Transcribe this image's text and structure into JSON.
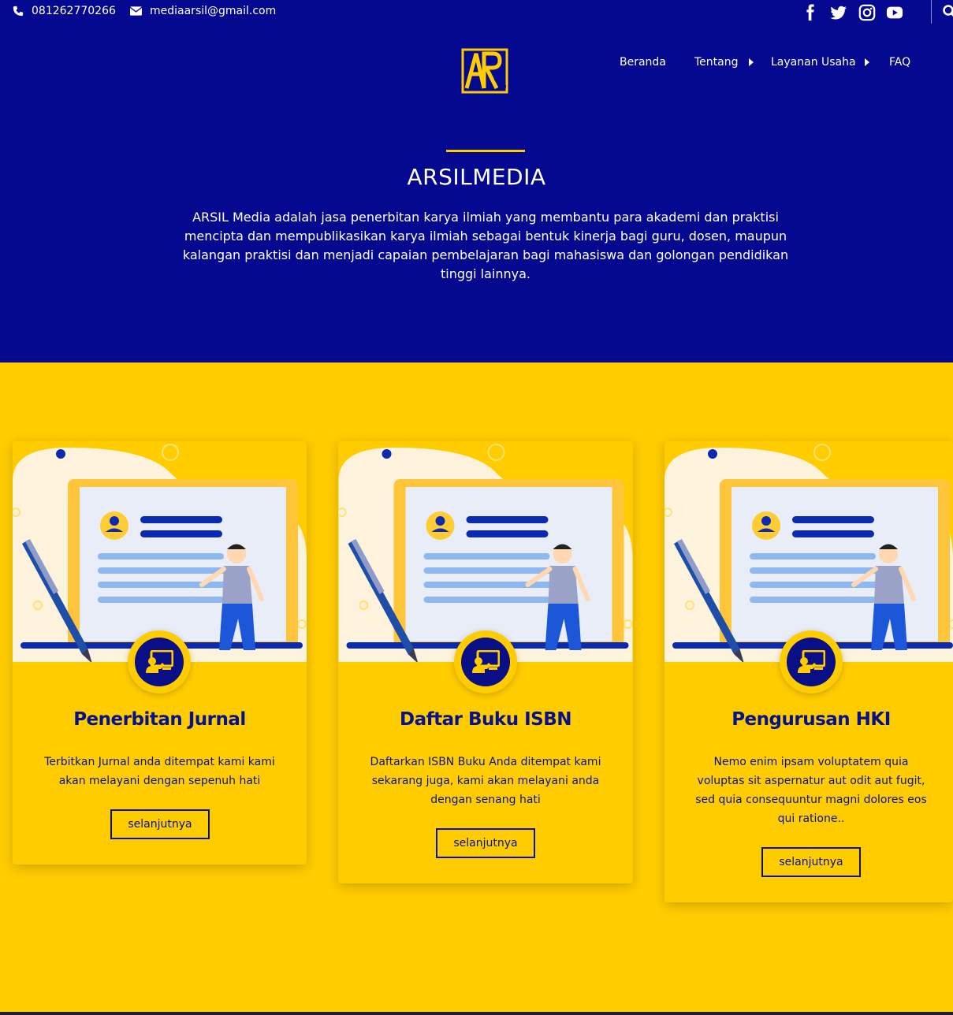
{
  "topbar": {
    "phone": "081262770266",
    "email": "mediaarsil@gmail.com",
    "social": [
      "facebook-icon",
      "twitter-icon",
      "instagram-icon",
      "youtube-icon"
    ]
  },
  "nav": {
    "items": [
      {
        "label": "Beranda",
        "has_submenu": false
      },
      {
        "label": "Tentang",
        "has_submenu": true
      },
      {
        "label": "Layanan Usaha",
        "has_submenu": true
      },
      {
        "label": "FAQ",
        "has_submenu": false
      }
    ]
  },
  "hero": {
    "title": "ARSILMEDIA",
    "description": "ARSIL Media adalah jasa penerbitan karya ilmiah yang membantu para akademi dan praktisi mencipta dan mempublikasikan karya ilmiah sebagai bentuk kinerja bagi guru, dosen, maupun kalangan praktisi dan menjadi capaian pembelajaran bagi mahasiswa dan golongan pendidikan tinggi lainnya."
  },
  "cards": [
    {
      "title": "Penerbitan Jurnal",
      "text": "Terbitkan Jurnal anda ditempat kami kami akan melayani dengan sepenuh hati",
      "button": "selanjutnya"
    },
    {
      "title": "Daftar Buku ISBN",
      "text": "Daftarkan ISBN Buku Anda ditempat kami sekarang juga, kami akan melayani anda dengan senang hati",
      "button": "selanjutnya"
    },
    {
      "title": "Pengurusan HKI",
      "text": "Nemo enim ipsam voluptatem quia voluptas sit aspernatur aut odit aut fugit, sed quia consequuntur magni dolores eos qui ratione..",
      "button": "selanjutnya"
    }
  ],
  "colors": {
    "hero_bg": "#05098f",
    "accent": "#ffcc00",
    "text_dark": "#07118a"
  }
}
